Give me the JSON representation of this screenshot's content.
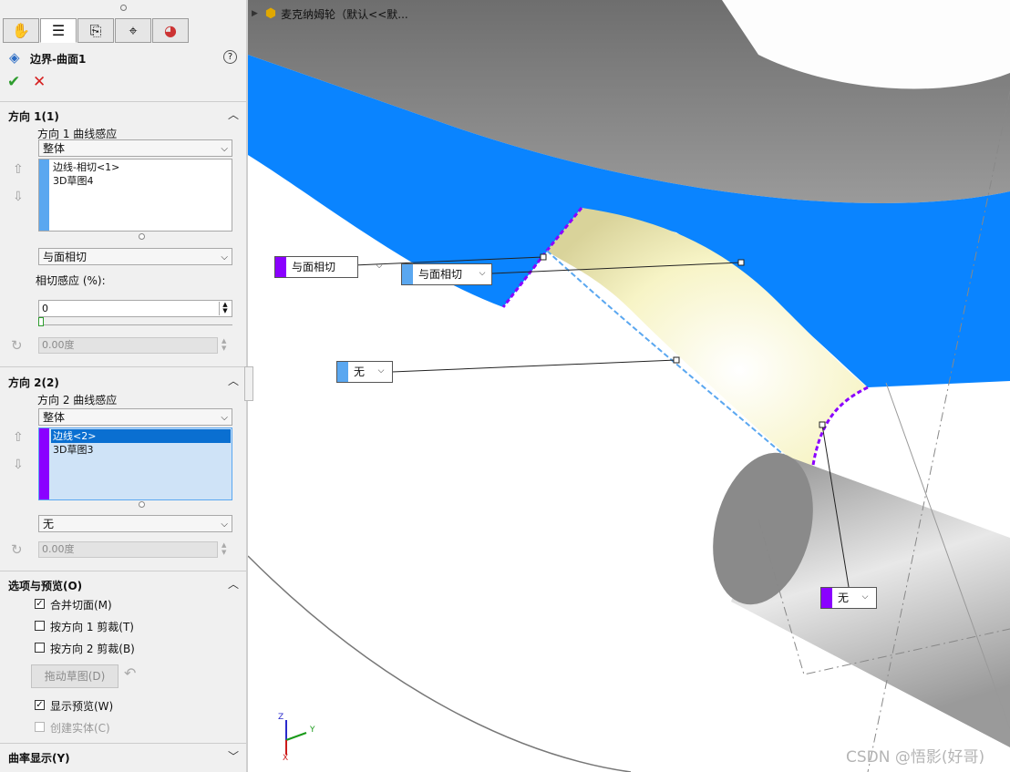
{
  "colors": {
    "accent_blue": "#0a6fd1",
    "surface_blue": "#0a84ff",
    "purple": "#8a00ff",
    "light_blue": "#5aa7f0",
    "green_check": "#2e9c2e",
    "red_x": "#d62020"
  },
  "tree_header": {
    "label": "麦克纳姆轮（默认<<默..."
  },
  "feature": {
    "title": "边界-曲面1",
    "help_icon": "question-mark-icon",
    "ok_icon": "check-icon",
    "cancel_icon": "x-icon"
  },
  "tabs": [
    {
      "icon": "feature-manager-icon"
    },
    {
      "icon": "property-manager-icon"
    },
    {
      "icon": "configuration-manager-icon"
    },
    {
      "icon": "dimxpert-icon"
    },
    {
      "icon": "display-manager-icon"
    }
  ],
  "dir1": {
    "title": "方向 1(1)",
    "curve_label": "方向 1 曲线感应",
    "curve_value": "整体",
    "items": [
      "边线-相切<1>",
      "3D草图4"
    ],
    "tangency_value": "与面相切",
    "influence_label": "相切感应 (%):",
    "influence_value": "0",
    "angle_value": "0.00度"
  },
  "dir2": {
    "title": "方向 2(2)",
    "curve_label": "方向 2 曲线感应",
    "curve_value": "整体",
    "items": [
      "边线<2>",
      "3D草图3"
    ],
    "tangency_value": "无",
    "angle_value": "0.00度"
  },
  "options": {
    "title": "选项与预览(O)",
    "merge_faces": "合并切面(M)",
    "trim_dir1": "按方向 1 剪裁(T)",
    "trim_dir2": "按方向 2 剪裁(B)",
    "drag_sketch": "拖动草图(D)",
    "show_preview": "显示预览(W)",
    "create_solid": "创建实体(C)",
    "merge_faces_checked": true,
    "trim_dir1_checked": false,
    "trim_dir2_checked": false,
    "show_preview_checked": true,
    "create_solid_checked": false
  },
  "curvature": {
    "title": "曲率显示(Y)"
  },
  "viewport": {
    "callout_1": "与面相切",
    "callout_2": "与面相切",
    "callout_3": "无",
    "callout_4": "无",
    "watermark": "CSDN @悟影(好哥)",
    "triad_z": "Z",
    "triad_y": "Y",
    "triad_x": "X"
  }
}
